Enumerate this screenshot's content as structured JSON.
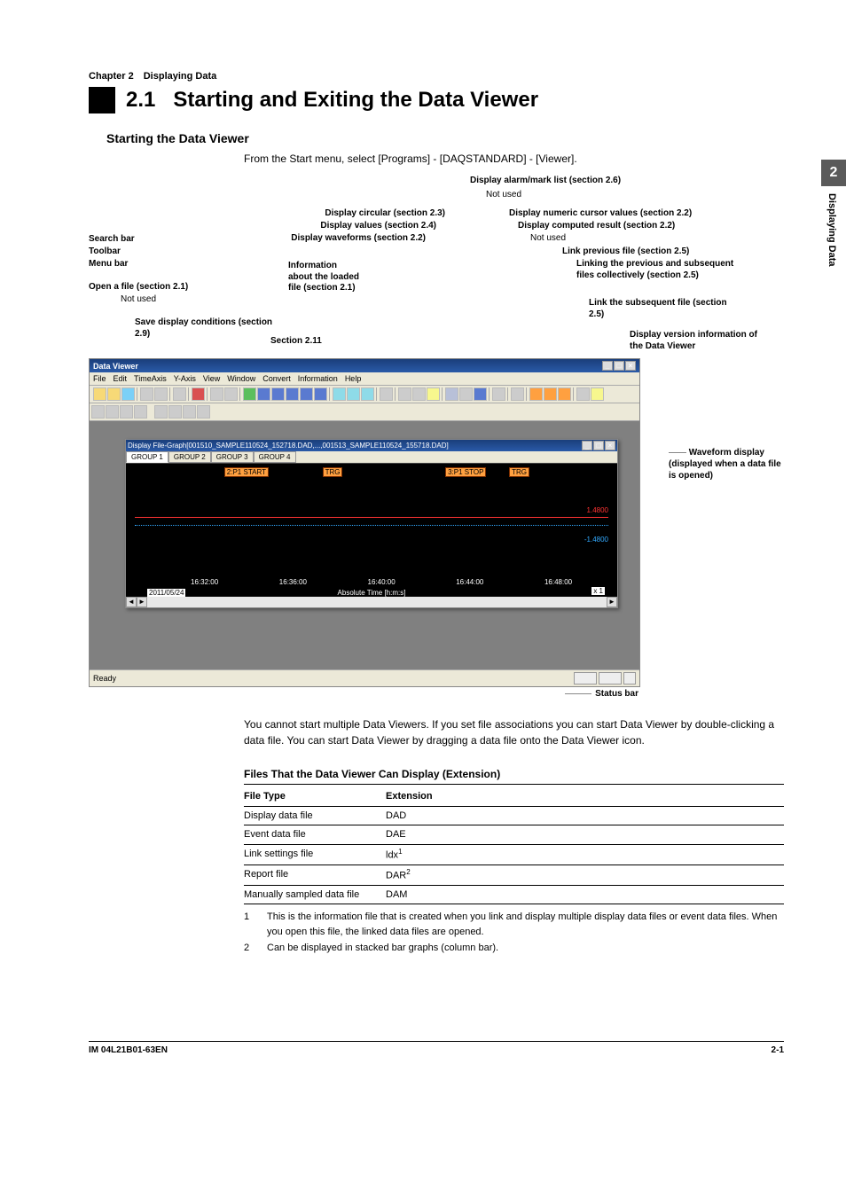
{
  "chapter_header": "Chapter 2 Displaying Data",
  "section_number": "2.1",
  "section_title": "Starting and Exiting the Data Viewer",
  "side_tab": {
    "num": "2",
    "text": "Displaying Data"
  },
  "subhead": "Starting the Data Viewer",
  "intro_line": "From the Start menu, select [Programs] - [DAQSTANDARD] - [Viewer].",
  "callouts": {
    "left": {
      "search_bar": "Search bar",
      "toolbar": "Toolbar",
      "menu_bar": "Menu bar",
      "open_file": "Open a file (section 2.1)",
      "not_used1": "Not used",
      "save_cond": "Save display conditions (section 2.9)",
      "info_about": "Information about the loaded file (section 2.1)",
      "section_211": "Section 2.11"
    },
    "mid": {
      "display_circular": "Display circular (section 2.3)",
      "display_values": "Display values (section 2.4)",
      "display_waveforms": "Display waveforms (section 2.2)"
    },
    "right": {
      "alarm_mark": "Display alarm/mark list (section 2.6)",
      "not_used2": "Not used",
      "numeric_cursor": "Display numeric cursor values (section 2.2)",
      "computed": "Display computed result (section 2.2)",
      "not_used3": "Not used",
      "link_prev": "Link previous file (section 2.5)",
      "link_both": "Linking the previous and subsequent files collectively (section 2.5)",
      "link_next": "Link the subsequent file (section 2.5)",
      "version": "Display version information of the Data Viewer"
    },
    "waveform_note": "Waveform display (displayed when a data file is opened)",
    "status_bar": "Status bar"
  },
  "screenshot": {
    "title": "Data Viewer",
    "menus": [
      "File",
      "Edit",
      "TimeAxis",
      "Y-Axis",
      "View",
      "Window",
      "Convert",
      "Information",
      "Help"
    ],
    "child_title": "Display File-Graph[001510_SAMPLE110524_152718.DAD,...,001513_SAMPLE110524_155718.DAD]",
    "tabs": [
      "GROUP 1",
      "GROUP 2",
      "GROUP 3",
      "GROUP 4"
    ],
    "markers": {
      "m1": "2:P1 START",
      "m2": "TRG",
      "m3": "3:P1 STOP",
      "m4": "TRG"
    },
    "val_r": "1.4800",
    "val_b": "-1.4800",
    "ticks": [
      "16:32:00",
      "16:36:00",
      "16:40:00",
      "16:44:00",
      "16:48:00"
    ],
    "xlabel": "Absolute Time [h:m:s]",
    "date": "2011/05/24",
    "zoom": "x 1",
    "status": "Ready"
  },
  "para1": "You cannot start multiple Data Viewers. If you set file associations you can start Data Viewer by double-clicking a data file. You can start Data Viewer by dragging a data file onto the Data Viewer icon.",
  "table": {
    "caption": "Files That the Data Viewer Can Display (Extension)",
    "head": [
      "File Type",
      "Extension"
    ],
    "rows": [
      [
        "Display data file",
        "DAD"
      ],
      [
        "Event data file",
        "DAE"
      ],
      [
        "Link settings file",
        "ldx",
        "1"
      ],
      [
        "Report file",
        "DAR",
        "2"
      ],
      [
        "Manually sampled data file",
        "DAM"
      ]
    ],
    "footnotes": [
      [
        "1",
        "This is the information file that is created when you link and display multiple display data files or event data files. When you open this file, the linked data files are opened."
      ],
      [
        "2",
        "Can be displayed in stacked bar graphs (column bar)."
      ]
    ]
  },
  "footer": {
    "left": "IM 04L21B01-63EN",
    "right": "2-1"
  }
}
